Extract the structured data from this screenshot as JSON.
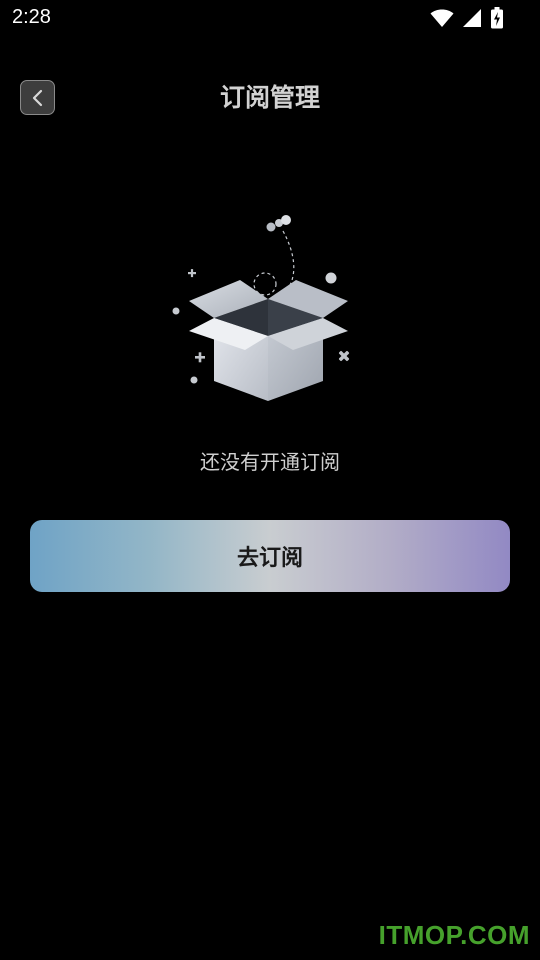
{
  "status_bar": {
    "time": "2:28",
    "icons": [
      "wifi-icon",
      "cellular-signal-icon",
      "battery-charging-icon"
    ]
  },
  "header": {
    "back_icon": "chevron-left-icon",
    "title": "订阅管理"
  },
  "empty_state": {
    "illustration": "open-box-icon",
    "message": "还没有开通订阅"
  },
  "actions": {
    "subscribe_label": "去订阅"
  },
  "watermark": {
    "text": "ITMOP.COM"
  },
  "colors": {
    "background": "#000000",
    "title": "#d2d2d2",
    "message": "#cfcfcf",
    "button_gradient_start": "#6fa3c6",
    "button_gradient_mid": "#c9cdd0",
    "button_gradient_end": "#9289c4",
    "watermark": "#46a12c"
  }
}
